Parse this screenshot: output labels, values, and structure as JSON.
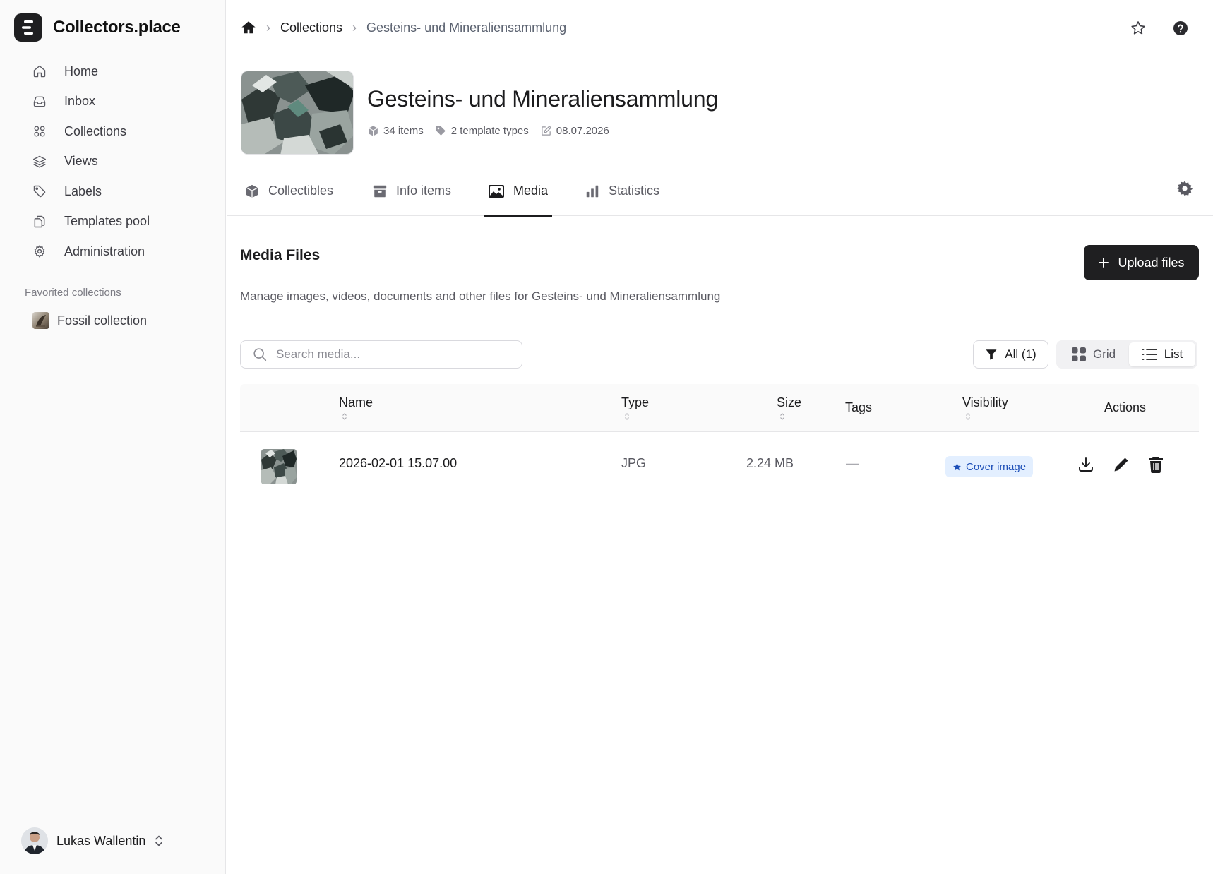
{
  "app": {
    "name": "Collectors.place"
  },
  "sidebar": {
    "items": [
      {
        "label": "Home",
        "icon": "home-icon"
      },
      {
        "label": "Inbox",
        "icon": "inbox-icon"
      },
      {
        "label": "Collections",
        "icon": "grid-icon"
      },
      {
        "label": "Views",
        "icon": "layers-icon"
      },
      {
        "label": "Labels",
        "icon": "tag-icon"
      },
      {
        "label": "Templates pool",
        "icon": "copy-icon"
      },
      {
        "label": "Administration",
        "icon": "gear-icon"
      }
    ],
    "favorites_title": "Favorited collections",
    "favorites": [
      {
        "label": "Fossil collection"
      }
    ],
    "user": {
      "name": "Lukas Wallentin"
    }
  },
  "breadcrumb": {
    "items": [
      "Collections",
      "Gesteins- und Mineraliensammlung"
    ]
  },
  "collection": {
    "title": "Gesteins- und Mineraliensammlung",
    "items_count": "34 items",
    "template_types": "2 template types",
    "date": "08.07.2026"
  },
  "tabs": [
    {
      "label": "Collectibles",
      "icon": "cube-icon"
    },
    {
      "label": "Info items",
      "icon": "archive-icon"
    },
    {
      "label": "Media",
      "icon": "image-icon",
      "active": true
    },
    {
      "label": "Statistics",
      "icon": "bar-chart-icon"
    }
  ],
  "media": {
    "title": "Media Files",
    "description": "Manage images, videos, documents and other files for Gesteins- und Mineraliensammlung",
    "upload_label": "Upload files",
    "search_placeholder": "Search media...",
    "filter_label": "All (1)",
    "view_grid": "Grid",
    "view_list": "List",
    "view_active": "List"
  },
  "table": {
    "columns": {
      "name": "Name",
      "type": "Type",
      "size": "Size",
      "tags": "Tags",
      "visibility": "Visibility",
      "actions": "Actions"
    },
    "rows": [
      {
        "name": "2026-02-01 15.07.00",
        "type": "JPG",
        "size": "2.24 MB",
        "tags": "—",
        "visibility": "Cover image"
      }
    ]
  },
  "colors": {
    "accent": "#1f1f21",
    "badge_bg": "#e3efff",
    "badge_text": "#1d4fb8",
    "sidebar_bg": "#fafafa"
  }
}
